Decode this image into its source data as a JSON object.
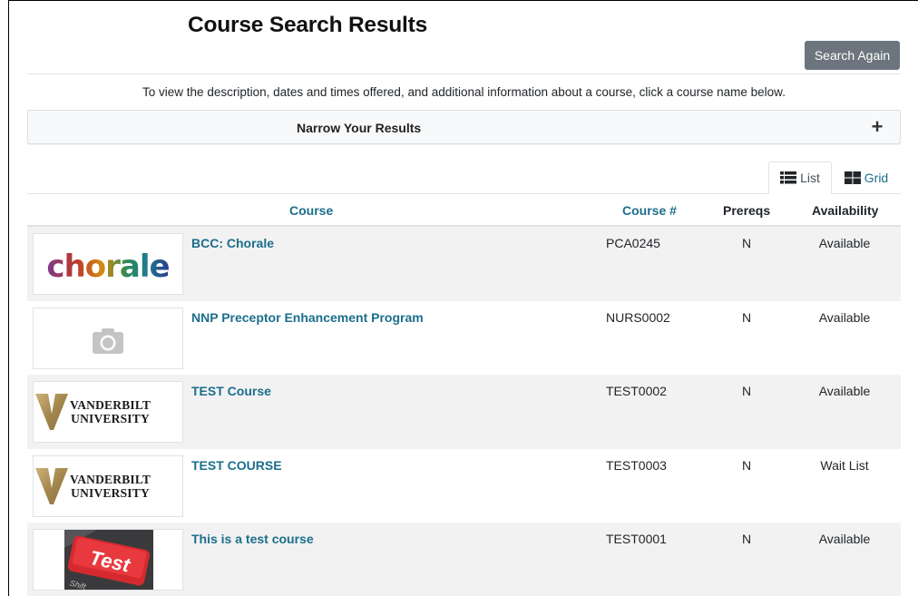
{
  "page": {
    "title": "Course Search Results",
    "search_again_label": "Search Again",
    "instructions": "To view the description, dates and times offered, and additional information about a course, click a course name below.",
    "narrow_label": "Narrow Your Results",
    "view_toggle": {
      "list_label": "List",
      "grid_label": "Grid",
      "active": "List"
    }
  },
  "table": {
    "headers": {
      "course": "Course",
      "course_num": "Course #",
      "prereqs": "Prereqs",
      "availability": "Availability"
    },
    "rows": [
      {
        "image": "chorale-logo",
        "image_text": "chorale",
        "name": "BCC: Chorale",
        "number": "PCA0245",
        "prereqs": "N",
        "availability": "Available"
      },
      {
        "image": "camera-icon",
        "name": "NNP Preceptor Enhancement Program",
        "number": "NURS0002",
        "prereqs": "N",
        "availability": "Available"
      },
      {
        "image": "vanderbilt-logo",
        "image_text": [
          "VANDERBILT",
          "UNIVERSITY"
        ],
        "name": "TEST Course",
        "number": "TEST0002",
        "prereqs": "N",
        "availability": "Available"
      },
      {
        "image": "vanderbilt-logo",
        "image_text": [
          "VANDERBILT",
          "UNIVERSITY"
        ],
        "name": "TEST COURSE",
        "number": "TEST0003",
        "prereqs": "N",
        "availability": "Wait List"
      },
      {
        "image": "test-key-photo",
        "image_text": [
          "Test",
          "Shift"
        ],
        "name": "This is a test course",
        "number": "TEST0001",
        "prereqs": "N",
        "availability": "Available"
      }
    ]
  },
  "colors": {
    "link": "#1b6e8c",
    "button": "#6c757d",
    "stripe": "#f2f2f2",
    "vanderbilt_gold": "#b89b5e"
  }
}
